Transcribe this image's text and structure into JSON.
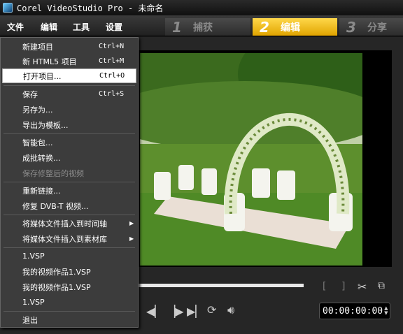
{
  "window": {
    "title": "Corel VideoStudio Pro - 未命名"
  },
  "menubar": {
    "items": [
      "文件",
      "编辑",
      "工具",
      "设置"
    ]
  },
  "steps": [
    {
      "num": "1",
      "label": "捕获"
    },
    {
      "num": "2",
      "label": "编辑"
    },
    {
      "num": "3",
      "label": "分享"
    }
  ],
  "active_step": "编辑",
  "file_menu": [
    {
      "label": "新建项目",
      "shortcut": "Ctrl+N"
    },
    {
      "label": "新 HTML5 项目",
      "shortcut": "Ctrl+M"
    },
    {
      "label": "打开项目...",
      "shortcut": "Ctrl+O",
      "selected": true
    },
    {
      "label": "保存",
      "shortcut": "Ctrl+S"
    },
    {
      "label": "另存为..."
    },
    {
      "label": "导出为模板..."
    },
    {
      "label": "智能包..."
    },
    {
      "label": "成批转换..."
    },
    {
      "label": "保存修整后的视频",
      "disabled": true
    },
    {
      "label": "重新链接..."
    },
    {
      "label": "修复 DVB-T 视频..."
    },
    {
      "label": "将媒体文件插入到时间轴",
      "submenu": true
    },
    {
      "label": "将媒体文件插入到素材库",
      "submenu": true
    },
    {
      "label": "1.VSP"
    },
    {
      "label": "我的视频作品1.VSP"
    },
    {
      "label": "我的视频作品1.VSP"
    },
    {
      "label": "1.VSP"
    },
    {
      "label": "退出"
    }
  ],
  "player": {
    "bracket_in": "[",
    "bracket_out": "]",
    "timecode": "00:00:00:00"
  },
  "colors": {
    "active_step": "#f0b800",
    "menu_bg": "#3c3c3c",
    "selection": "#ffffff"
  }
}
